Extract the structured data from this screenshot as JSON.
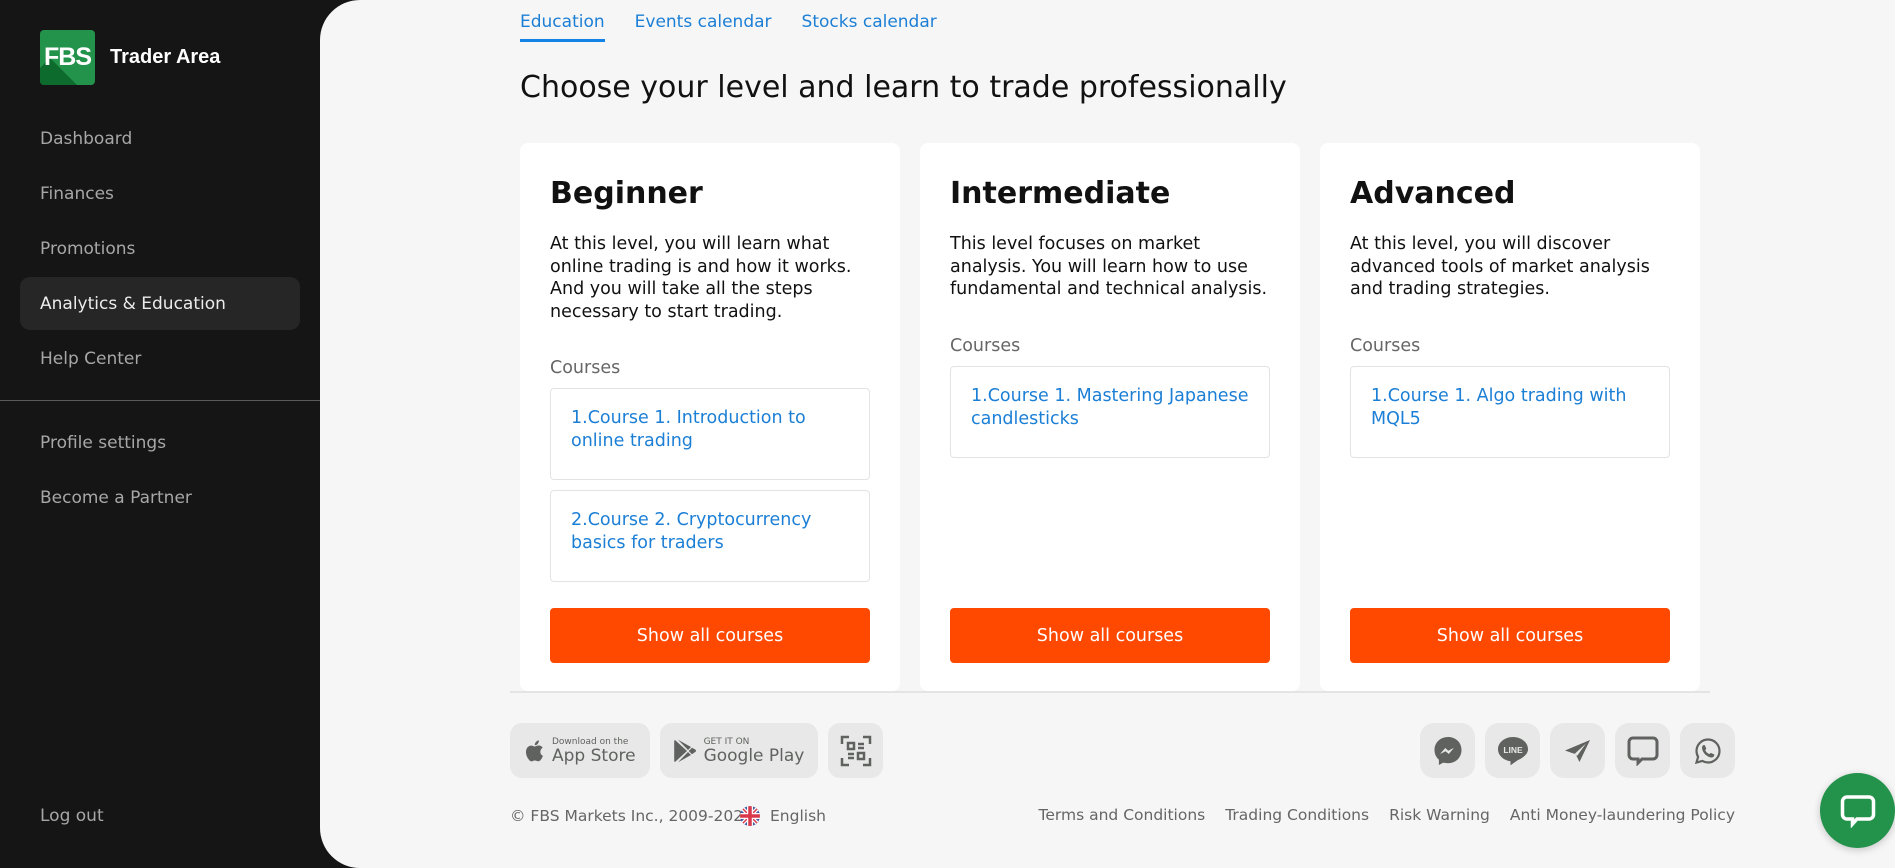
{
  "sidebar": {
    "logo_mark": "FBS",
    "logo_text": "Trader Area",
    "nav": [
      {
        "label": "Dashboard",
        "active": false
      },
      {
        "label": "Finances",
        "active": false
      },
      {
        "label": "Promotions",
        "active": false
      },
      {
        "label": "Analytics & Education",
        "active": true
      },
      {
        "label": "Help Center",
        "active": false
      }
    ],
    "nav_secondary": [
      {
        "label": "Profile settings"
      },
      {
        "label": "Become a Partner"
      }
    ],
    "logout": "Log out"
  },
  "main": {
    "tabs": [
      {
        "label": "Education",
        "active": true
      },
      {
        "label": "Events calendar",
        "active": false
      },
      {
        "label": "Stocks calendar",
        "active": false
      }
    ],
    "title": "Choose your level and learn to trade professionally",
    "levels": [
      {
        "name": "Beginner",
        "description": "At this level, you will learn what online trading is and how it works. And you will take all the steps necessary to start trading.",
        "courses_label": "Courses",
        "courses": [
          "1.Course 1. Introduction to online trading",
          "2.Course 2. Cryptocurrency basics for traders"
        ],
        "button": "Show all courses"
      },
      {
        "name": "Intermediate",
        "description": "This level focuses on market analysis. You will learn how to use fundamental and technical analysis.",
        "courses_label": "Courses",
        "courses": [
          "1.Course 1. Mastering Japanese candlesticks"
        ],
        "button": "Show all courses"
      },
      {
        "name": "Advanced",
        "description": "At this level, you will discover advanced tools of market analysis and trading strategies.",
        "courses_label": "Courses",
        "courses": [
          "1.Course 1. Algo trading with MQL5"
        ],
        "button": "Show all courses"
      }
    ]
  },
  "footer": {
    "app_store": {
      "small": "Download on the",
      "big": "App Store",
      "icon": "apple-icon"
    },
    "google_play": {
      "small": "GET IT ON",
      "big": "Google Play",
      "icon": "google-play-icon"
    },
    "qr_icon": "qr-code-icon",
    "social": [
      "messenger-icon",
      "line-icon",
      "telegram-icon",
      "live-chat-icon",
      "whatsapp-icon"
    ],
    "line_label": "LINE",
    "copyright": "© FBS Markets Inc., 2009-2024",
    "language": "English",
    "legal_links": [
      "Terms and Conditions",
      "Trading Conditions",
      "Risk Warning",
      "Anti Money-laundering Policy"
    ]
  },
  "colors": {
    "brand_green": "#23924a",
    "accent_orange": "#ff4800",
    "link_blue": "#1c7fd6",
    "sidebar_bg": "#151515",
    "main_bg": "#f6f6f6"
  }
}
